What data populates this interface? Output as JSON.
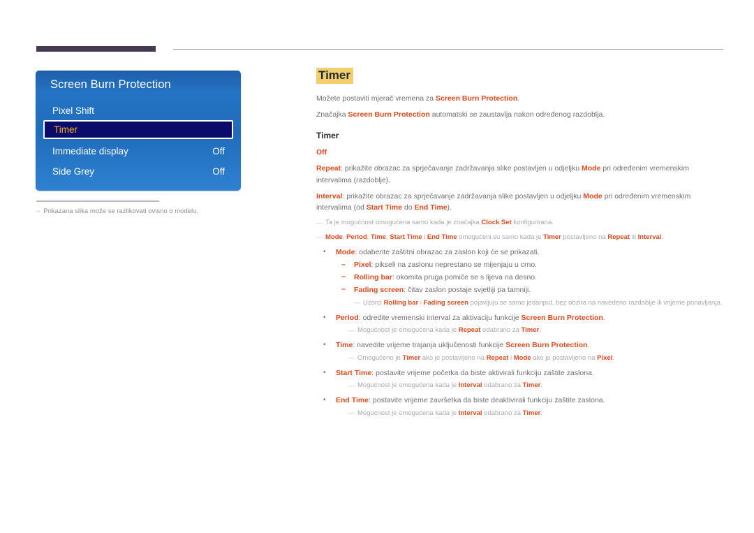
{
  "header": {
    "tab_marker": "",
    "rule": ""
  },
  "osd": {
    "title": "Screen Burn Protection",
    "items": [
      {
        "label": "Pixel Shift",
        "value": "",
        "selected": false
      },
      {
        "label": "Timer",
        "value": "",
        "selected": true
      },
      {
        "label": "Immediate display",
        "value": "Off",
        "selected": false
      },
      {
        "label": "Side Grey",
        "value": "Off",
        "selected": false
      }
    ],
    "footnote_dash": "–",
    "footnote": "Prikazana slika može se razlikovati ovisno o modelu."
  },
  "content": {
    "title": "Timer",
    "intro": [
      {
        "pre": "Možete postaviti mjerač vremena za ",
        "key": "Screen Burn Protection",
        "post": "."
      },
      {
        "pre": "Značajka ",
        "key": "Screen Burn Protection",
        "post": " automatski se zaustavlja nakon određenog razdoblja."
      }
    ],
    "sub_head": "Timer",
    "option_off": "Off",
    "repeat": {
      "key": "Repeat",
      "t1": ": prikažite obrazac za sprječavanje zadržavanja slike postavljen u odjeljku ",
      "k2": "Mode",
      "t2": " pri određenim vremenskim intervalima (razdoblje)."
    },
    "interval": {
      "key": "Interval",
      "t1": ": prikažite obrazac za sprječavanje zadržavanja slike postavljen u odjeljku ",
      "k2": "Mode",
      "t2": " pri određenim vremenskim intervalima (od ",
      "k3": "Start Time",
      "t3": " do ",
      "k4": "End Time",
      "t4": ")."
    },
    "note_clock": {
      "dash": "—",
      "t1": "Ta je mogućnost omogućena samo kada je značajka ",
      "k1": "Clock Set",
      "t2": " konfigurirana."
    },
    "note_modes": {
      "dash": "—",
      "k1": "Mode",
      "s1": ", ",
      "k2": "Period",
      "s2": ", ",
      "k3": "Time",
      "s3": ", ",
      "k4": "Start Time",
      "s4": " i ",
      "k5": "End Time",
      "t1": " omogućeni su samo kada je ",
      "k6": "Timer",
      "t2": " postavljeno na ",
      "k7": "Repeat",
      "t3": " ili ",
      "k8": "Interval",
      "t4": "."
    },
    "bullets": {
      "mode": {
        "dot": "•",
        "key": "Mode",
        "text": ": odaberite zaštitni obrazac za zaslon koji će se prikazati.",
        "sub": [
          {
            "dash": "–",
            "key": "Pixel",
            "text": ": pikseli na zaslonu neprestano se mijenjaju u crno."
          },
          {
            "dash": "–",
            "key": "Rolling bar",
            "text": ": okomita pruga pomiče se s lijeva na desno."
          },
          {
            "dash": "–",
            "key": "Fading screen",
            "text": ": čitav zaslon postaje svjetliji pa tamniji."
          }
        ],
        "note": {
          "dash": "—",
          "t1": "Uzorci ",
          "k1": "Rolling bar",
          "t2": " i ",
          "k2": "Fading screen",
          "t3": " pojavljuju se samo jedanput, bez obzira na navedeno razdoblje ili vrijeme ponavljanja."
        }
      },
      "period": {
        "dot": "•",
        "key": "Period",
        "t1": ": odredite vremenski interval za aktivaciju funkcije ",
        "k2": "Screen Burn Protection",
        "t2": ".",
        "note": {
          "dash": "—",
          "t1": "Mogućnost je omogućena kada je ",
          "k1": "Repeat",
          "t2": " odabrano za ",
          "k2": "Timer",
          "t3": "."
        }
      },
      "time": {
        "dot": "•",
        "key": "Time",
        "t1": ": navedite vrijeme trajanja uključenosti funkcije ",
        "k2": "Screen Burn Protection",
        "t2": ".",
        "note": {
          "dash": "—",
          "t1": "Omogućeno je ",
          "k1": "Timer",
          "t2": " ako je postavljeno na ",
          "k2": "Repeat",
          "t3": " i ",
          "k3": "Mode",
          "t4": " ako je postavljeno na ",
          "k4": "Pixel",
          "t5": "."
        }
      },
      "start_time": {
        "dot": "•",
        "key": "Start Time",
        "text": ": postavite vrijeme početka da biste aktivirali funkciju zaštite zaslona.",
        "note": {
          "dash": "—",
          "t1": "Mogućnost je omogućena kada je ",
          "k1": "Interval",
          "t2": " odabrano za ",
          "k2": "Timer",
          "t3": "."
        }
      },
      "end_time": {
        "dot": "•",
        "key": "End Time",
        "text": ": postavite vrijeme završetka da biste deaktivirali funkciju zaštite zaslona.",
        "note": {
          "dash": "—",
          "t1": "Mogućnost je omogućena kada je ",
          "k1": "Interval",
          "t2": " odabrano za ",
          "k2": "Timer",
          "t3": "."
        }
      }
    }
  },
  "colors": {
    "accent": "#e0491c",
    "highlight": "#f2cf6b",
    "panel_blue": "#2573c4",
    "selected_navy": "#0b0b6b",
    "selected_text": "#f5b31a",
    "header_tab": "#453a52",
    "muted": "#a8a8ae",
    "body_text": "#6f6f74"
  }
}
